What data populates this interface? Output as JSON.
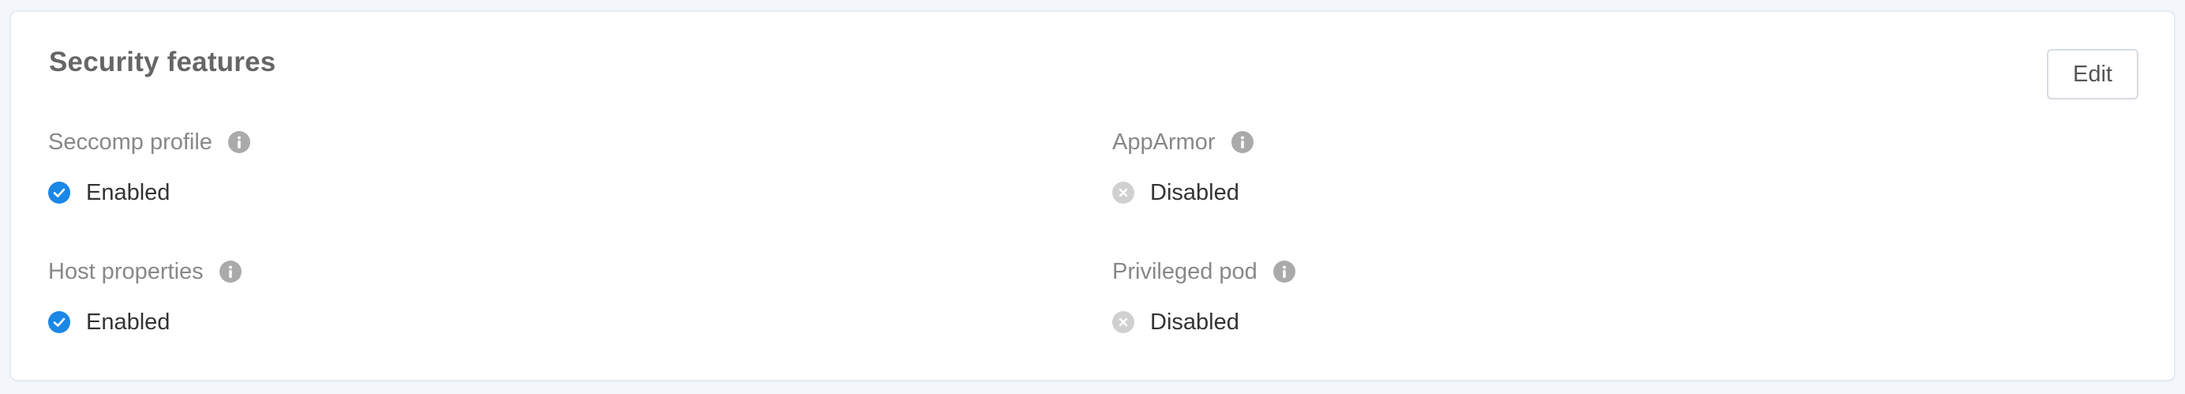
{
  "card": {
    "title": "Security features",
    "edit_label": "Edit"
  },
  "features": [
    {
      "label": "Seccomp profile",
      "status": "Enabled",
      "state": "enabled",
      "icon": "check-circle-icon"
    },
    {
      "label": "AppArmor",
      "status": "Disabled",
      "state": "disabled",
      "icon": "x-circle-icon"
    },
    {
      "label": "Host properties",
      "status": "Enabled",
      "state": "enabled",
      "icon": "check-circle-icon"
    },
    {
      "label": "Privileged pod",
      "status": "Disabled",
      "state": "disabled",
      "icon": "x-circle-icon"
    }
  ],
  "colors": {
    "enabled": "#1b87e6",
    "disabled": "#d0d0d0",
    "info": "#aaaaaa"
  }
}
